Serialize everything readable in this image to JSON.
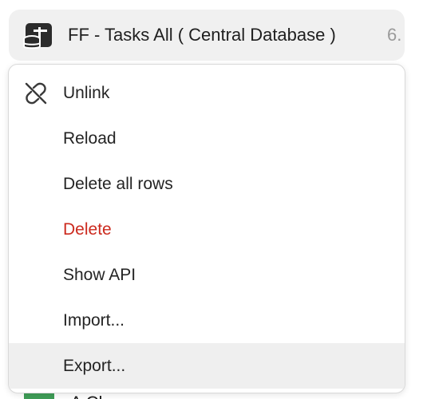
{
  "header": {
    "icon": "database-table-icon",
    "title": "FF - Tasks All ( Central Database )",
    "version_fragment": "6."
  },
  "menu": {
    "items": [
      {
        "label": "Unlink",
        "icon": "unlink-icon"
      },
      {
        "label": "Reload"
      },
      {
        "label": "Delete all rows"
      },
      {
        "label": "Delete",
        "color": "#cc2a1e"
      },
      {
        "label": "Show API"
      },
      {
        "label": "Import..."
      },
      {
        "label": "Export..."
      }
    ],
    "highlighted_item": "Export..."
  },
  "peek": {
    "text": "A  Ch"
  },
  "colors": {
    "header_bg": "#f0f0f0",
    "danger": "#cc2a1e",
    "hover_bg": "#efefef"
  }
}
